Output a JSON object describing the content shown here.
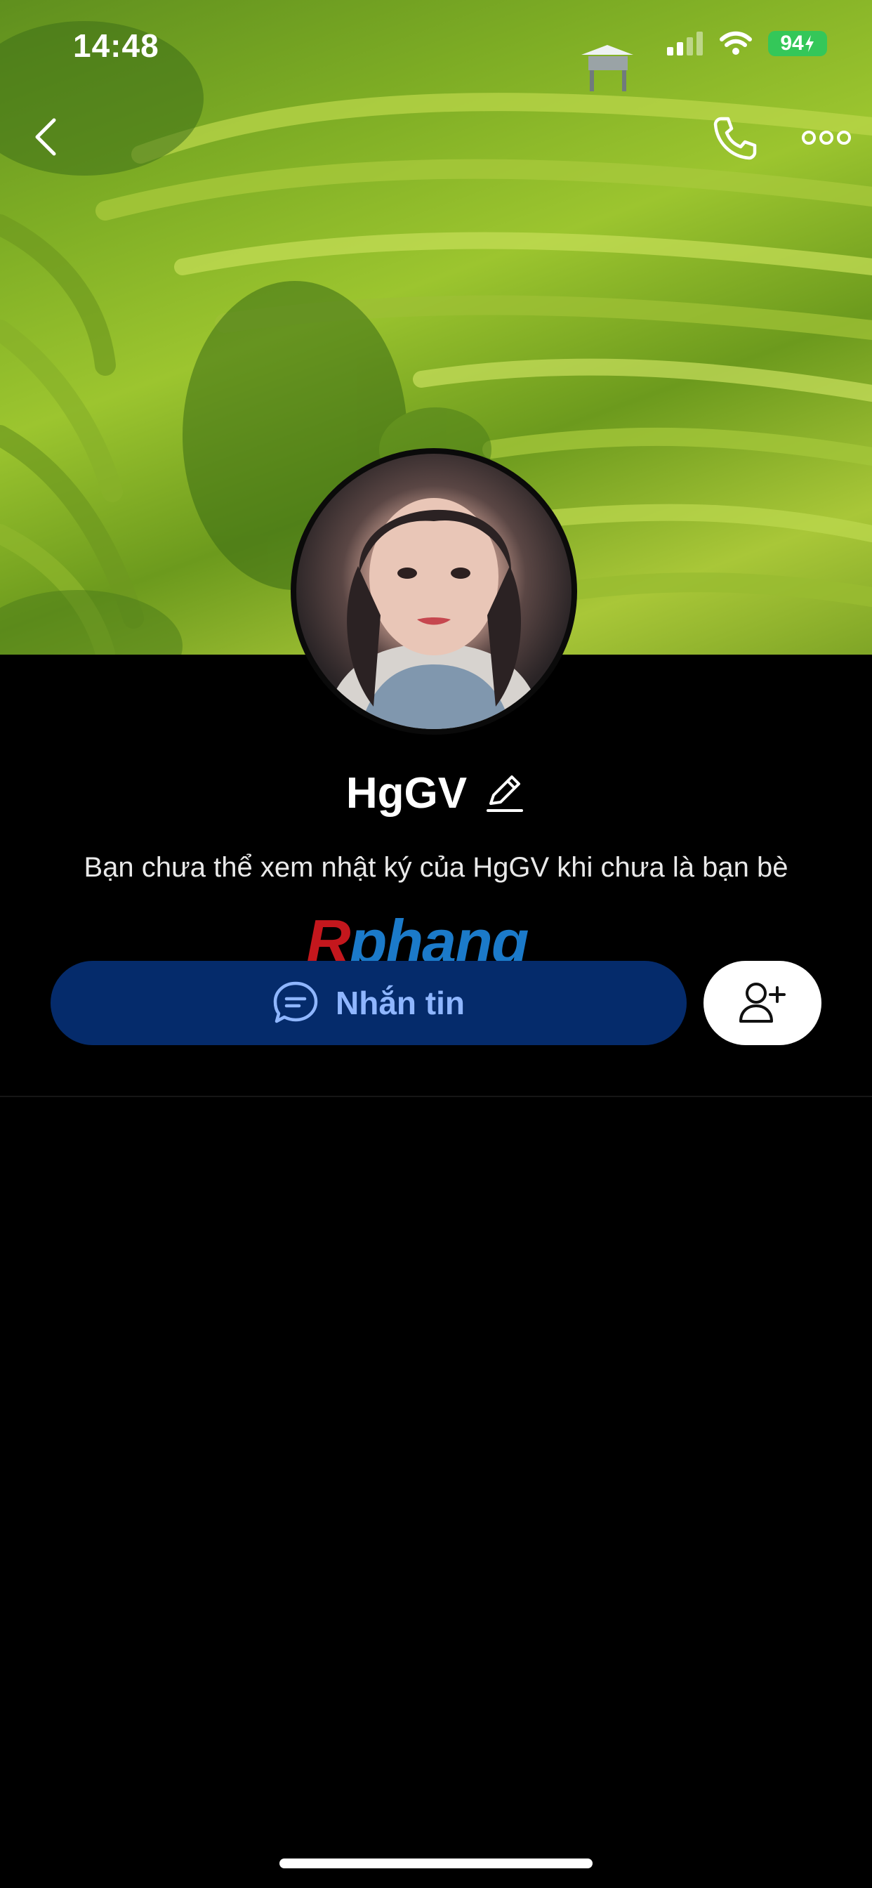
{
  "status_bar": {
    "time": "14:48",
    "battery": "94"
  },
  "icons": {
    "back": "chevron-left-icon",
    "call": "phone-icon",
    "more": "more-dots-icon",
    "edit": "pencil-icon",
    "message": "chat-bubble-icon",
    "add_friend": "add-user-icon"
  },
  "profile": {
    "name": "HgGV",
    "description": "Bạn chưa thể xem nhật ký của HgGV khi chưa là bạn bè"
  },
  "actions": {
    "message_label": "Nhắn tin"
  },
  "watermark": {
    "first": "R",
    "rest": "phang"
  },
  "colors": {
    "background": "#000000",
    "message_button": "#052b6b",
    "message_text": "#8fb6ff",
    "battery": "#34c759"
  }
}
